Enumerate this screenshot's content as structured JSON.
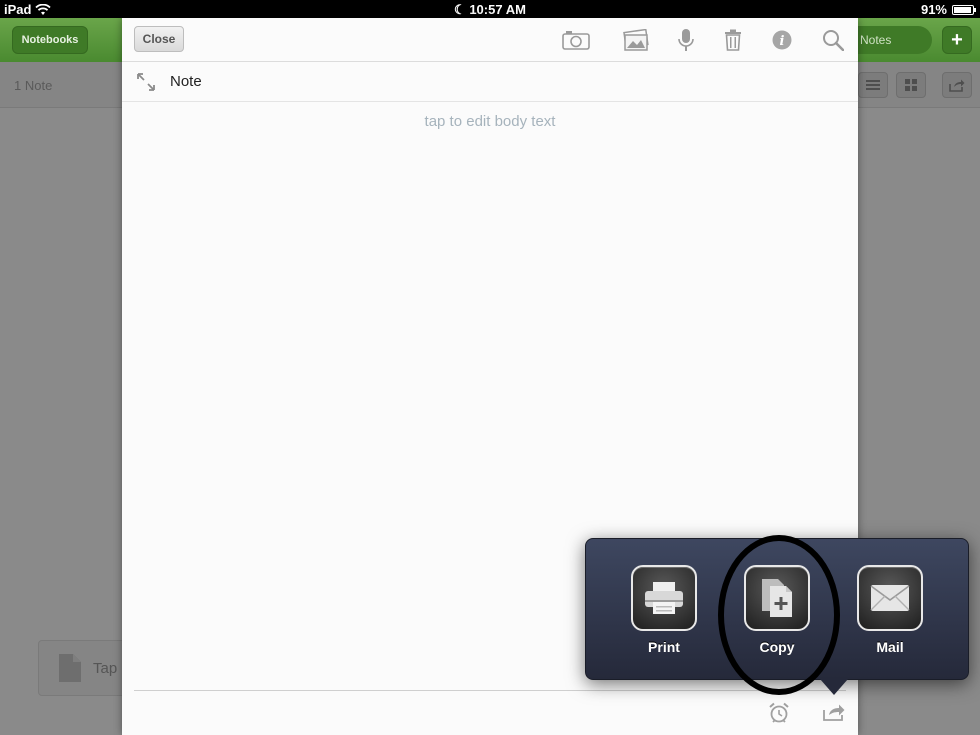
{
  "status_bar": {
    "device": "iPad",
    "time": "10:57 AM",
    "battery": "91%"
  },
  "background_app": {
    "notebooks_label": "Notebooks",
    "notes_label": "Notes",
    "add_label": "+",
    "note_count": "1 Note",
    "tap_row_label": "Tap"
  },
  "note_editor": {
    "close_label": "Close",
    "toolbar_icons": [
      "camera-icon",
      "photo-icon",
      "microphone-icon",
      "trash-icon",
      "info-icon",
      "search-icon"
    ],
    "title": "Note",
    "body_placeholder": "tap to edit body text"
  },
  "share_popover": {
    "items": [
      {
        "label": "Print",
        "icon": "printer-icon"
      },
      {
        "label": "Copy",
        "icon": "copy-icon"
      },
      {
        "label": "Mail",
        "icon": "mail-icon"
      }
    ],
    "highlighted": "Copy"
  },
  "colors": {
    "toolbar_green": "#4a8a30",
    "popover_bg": "#2e3447",
    "placeholder_text": "#a6b3bc"
  }
}
